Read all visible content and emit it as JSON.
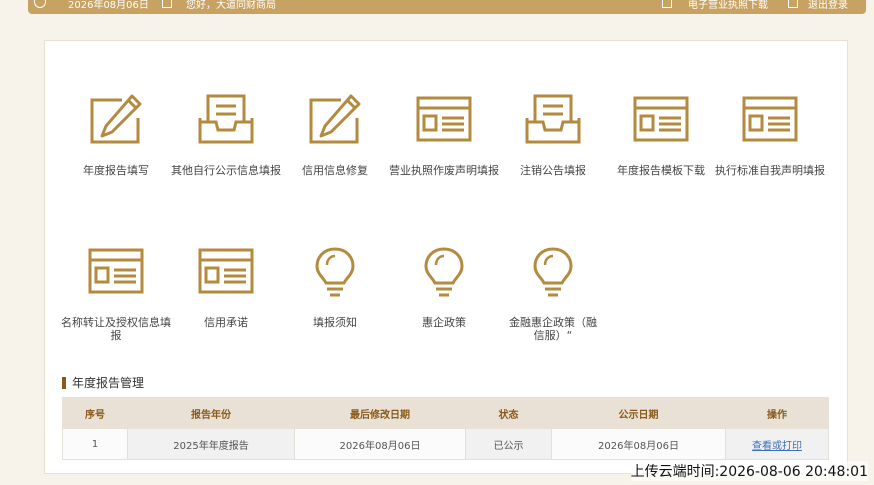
{
  "topbar": {
    "date_text": "2026年08月06日",
    "notice_text": "您好，大道同财商局",
    "download_text": "电子营业执照下载",
    "logout_text": "退出登录"
  },
  "colors": {
    "accent": "#b48a3f",
    "header_bg": "#c8a262",
    "link": "#3a6fb5"
  },
  "tiles": [
    {
      "label": "年度报告填写",
      "icon": "edit-icon"
    },
    {
      "label": "其他自行公示信息填报",
      "icon": "inbox-icon"
    },
    {
      "label": "信用信息修复",
      "icon": "edit-icon"
    },
    {
      "label": "营业执照作废声明填报",
      "icon": "form-window-icon"
    },
    {
      "label": "注销公告填报",
      "icon": "inbox-icon"
    },
    {
      "label": "年度报告模板下载",
      "icon": "form-window-icon"
    },
    {
      "label": "执行标准自我声明填报",
      "icon": "form-window-icon"
    },
    {
      "label": "名称转让及授权信息填报",
      "icon": "form-window-icon"
    },
    {
      "label": "信用承诺",
      "icon": "form-window-icon"
    },
    {
      "label": "填报须知",
      "icon": "lightbulb-icon"
    },
    {
      "label": "惠企政策",
      "icon": "lightbulb-icon"
    },
    {
      "label": "金融惠企政策（融信服）“",
      "icon": "lightbulb-icon"
    }
  ],
  "annual_report": {
    "title": "年度报告管理",
    "columns": [
      "序号",
      "报告年份",
      "最后修改日期",
      "状态",
      "公示日期",
      "操作"
    ],
    "rows": [
      {
        "index": "1",
        "year": "2025年年度报告",
        "modified": "2026年08月06日",
        "status": "已公示",
        "publish_date": "2026年08月06日",
        "action": "查看或打印"
      }
    ]
  },
  "watermark": "上传云端时间:2026-08-06 20:48:01"
}
